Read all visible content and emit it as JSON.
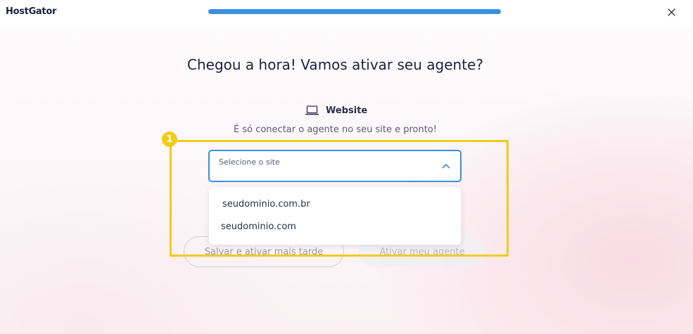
{
  "header": {
    "logo": "HostGator",
    "progress_percent": 100
  },
  "main": {
    "title": "Chegou a hora! Vamos ativar seu agente?",
    "channel_label": "Website",
    "subtitle": "É só conectar o agente no seu site e pronto!",
    "select": {
      "label": "Selecione o site",
      "options": [
        "seudominio.com.br",
        "seudominio.com"
      ]
    },
    "buttons": {
      "later": "Salvar e ativar mais tarde",
      "activate": "Ativar meu agente"
    }
  },
  "annotation": {
    "step_number": "1",
    "color": "#f1cc17"
  },
  "colors": {
    "accent": "#3a8fe0",
    "text": "#1d2140"
  },
  "icons": {
    "close": "close-icon",
    "channel": "laptop-icon",
    "chevron": "chevron-up-icon"
  }
}
